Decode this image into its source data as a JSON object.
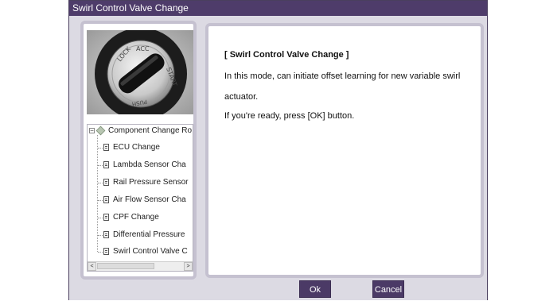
{
  "window": {
    "title": "Swirl Control Valve Change"
  },
  "tree": {
    "root_label": "Component Change Ro",
    "expand_glyph": "−",
    "items": [
      {
        "label": "ECU Change"
      },
      {
        "label": "Lambda Sensor Cha"
      },
      {
        "label": "Rail Pressure Sensor"
      },
      {
        "label": "Air Flow Sensor Cha"
      },
      {
        "label": "CPF Change"
      },
      {
        "label": "Differential Pressure"
      },
      {
        "label": "Swirl Control Valve C"
      }
    ],
    "scroll_left": "<",
    "scroll_right": ">"
  },
  "image": {
    "key_labels": [
      "LOCK",
      "ACC",
      "START",
      "PUSH"
    ]
  },
  "message": {
    "title": "[ Swirl Control Valve Change ]",
    "line1": "In this mode, can initiate offset learning for new variable swirl",
    "line2": "actuator.",
    "line3": "If you're ready, press [OK] button."
  },
  "buttons": {
    "ok": "Ok",
    "cancel": "Cancel"
  },
  "colors": {
    "titlebar": "#4e3c6a",
    "button": "#4b3a66",
    "panel_border": "#c5c1d0",
    "dialog_bg": "#dcdae3"
  }
}
